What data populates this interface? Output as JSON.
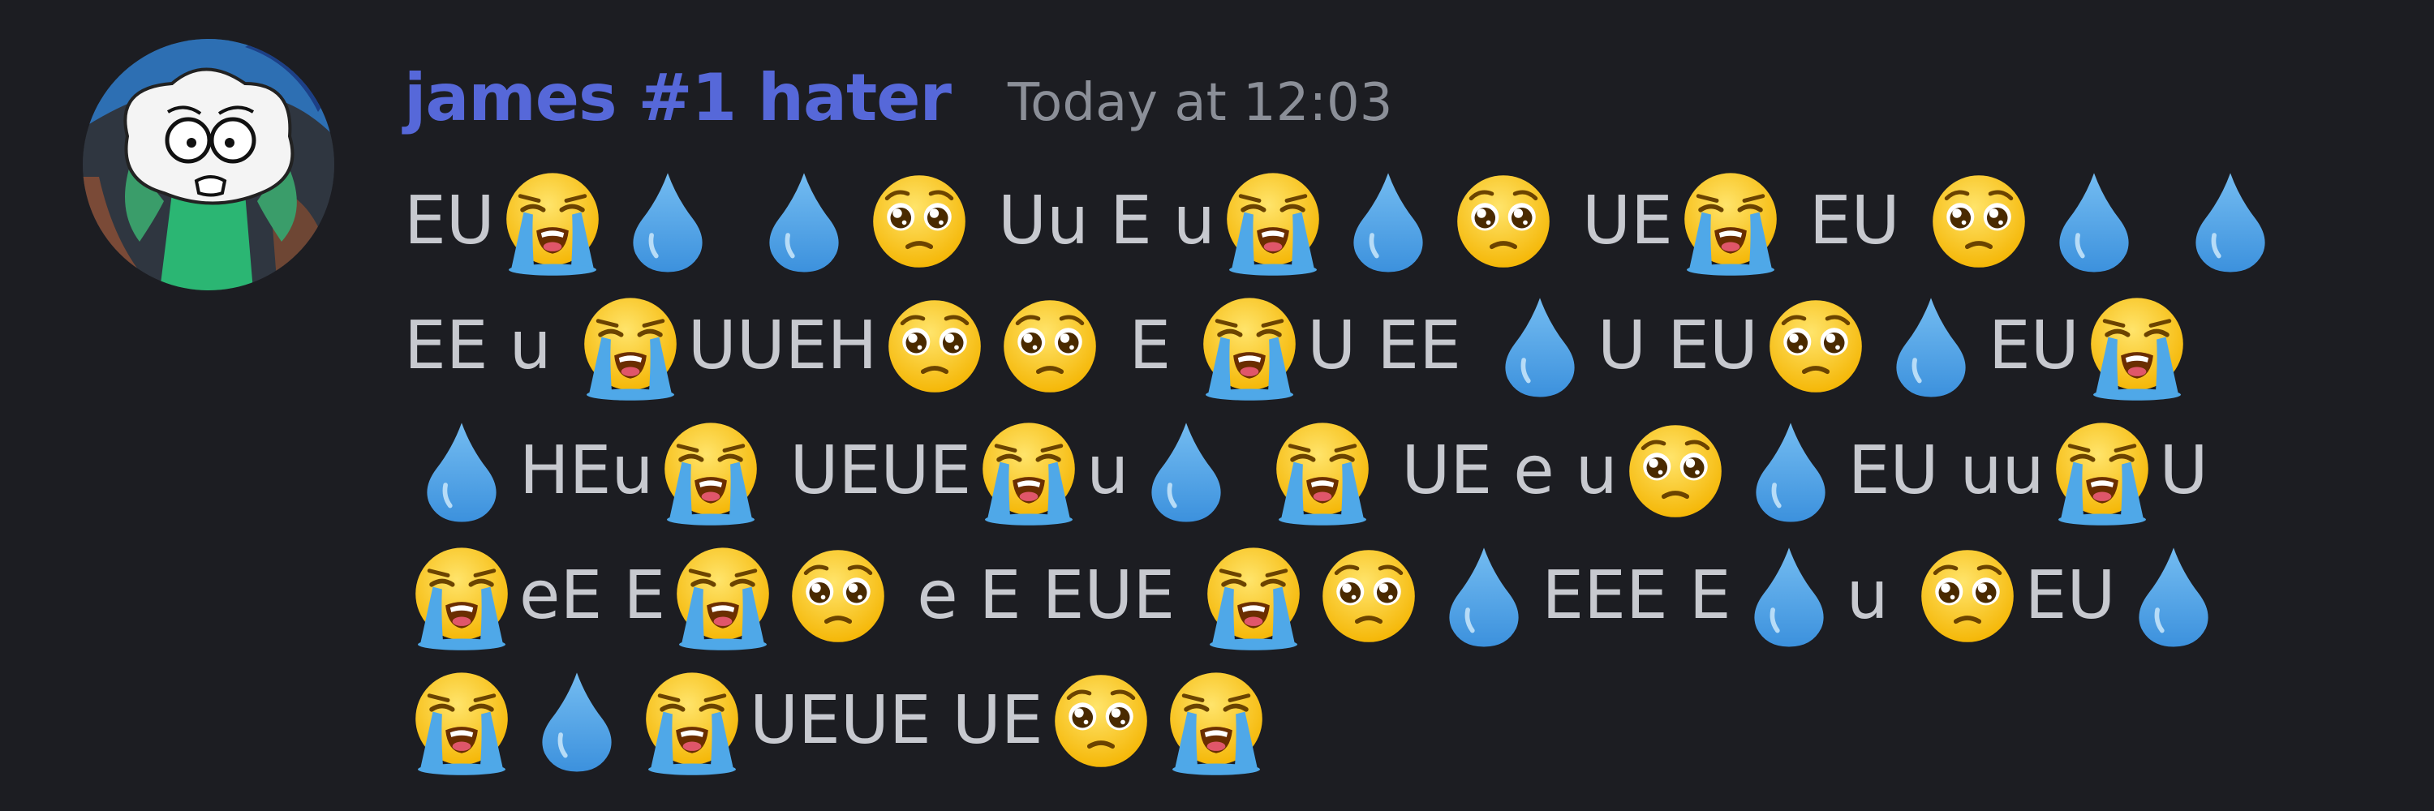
{
  "message": {
    "author": "james #1 hater",
    "timestamp": "Today at 12:03",
    "colors": {
      "author": "#5668d9",
      "timestamp": "#8b8f98",
      "text": "#c7c9cf",
      "background": "#1c1d22"
    },
    "lines": [
      [
        {
          "t": "text",
          "v": "EU"
        },
        {
          "t": "emoji",
          "v": "loudly-crying-face"
        },
        {
          "t": "emoji",
          "v": "droplet"
        },
        {
          "t": "text",
          "v": " "
        },
        {
          "t": "emoji",
          "v": "droplet"
        },
        {
          "t": "emoji",
          "v": "pleading-face"
        },
        {
          "t": "text",
          "v": " Uu E u"
        },
        {
          "t": "emoji",
          "v": "loudly-crying-face"
        },
        {
          "t": "emoji",
          "v": "droplet"
        },
        {
          "t": "emoji",
          "v": "pleading-face"
        },
        {
          "t": "text",
          "v": " UE"
        },
        {
          "t": "emoji",
          "v": "loudly-crying-face"
        },
        {
          "t": "text",
          "v": " EU "
        },
        {
          "t": "emoji",
          "v": "pleading-face"
        },
        {
          "t": "emoji",
          "v": "droplet"
        },
        {
          "t": "text",
          "v": " "
        },
        {
          "t": "emoji",
          "v": "droplet"
        }
      ],
      [
        {
          "t": "text",
          "v": "EE u "
        },
        {
          "t": "emoji",
          "v": "loudly-crying-face"
        },
        {
          "t": "text",
          "v": "UUEH"
        },
        {
          "t": "emoji",
          "v": "pleading-face"
        },
        {
          "t": "emoji",
          "v": "pleading-face"
        },
        {
          "t": "text",
          "v": " E "
        },
        {
          "t": "emoji",
          "v": "loudly-crying-face"
        },
        {
          "t": "text",
          "v": "U EE "
        },
        {
          "t": "emoji",
          "v": "droplet"
        },
        {
          "t": "text",
          "v": "U EU"
        },
        {
          "t": "emoji",
          "v": "pleading-face"
        },
        {
          "t": "emoji",
          "v": "droplet"
        },
        {
          "t": "text",
          "v": "EU"
        },
        {
          "t": "emoji",
          "v": "loudly-crying-face"
        }
      ],
      [
        {
          "t": "emoji",
          "v": "droplet"
        },
        {
          "t": "text",
          "v": "HEu"
        },
        {
          "t": "emoji",
          "v": "loudly-crying-face"
        },
        {
          "t": "text",
          "v": " UEUE"
        },
        {
          "t": "emoji",
          "v": "loudly-crying-face"
        },
        {
          "t": "text",
          "v": "u"
        },
        {
          "t": "emoji",
          "v": "droplet"
        },
        {
          "t": "text",
          "v": " "
        },
        {
          "t": "emoji",
          "v": "loudly-crying-face"
        },
        {
          "t": "text",
          "v": " UE e u"
        },
        {
          "t": "emoji",
          "v": "pleading-face"
        },
        {
          "t": "emoji",
          "v": "droplet"
        },
        {
          "t": "text",
          "v": "EU uu"
        },
        {
          "t": "emoji",
          "v": "loudly-crying-face"
        },
        {
          "t": "text",
          "v": "U"
        }
      ],
      [
        {
          "t": "emoji",
          "v": "loudly-crying-face"
        },
        {
          "t": "text",
          "v": "eE E"
        },
        {
          "t": "emoji",
          "v": "loudly-crying-face"
        },
        {
          "t": "emoji",
          "v": "pleading-face"
        },
        {
          "t": "text",
          "v": " e E EUE "
        },
        {
          "t": "emoji",
          "v": "loudly-crying-face"
        },
        {
          "t": "emoji",
          "v": "pleading-face"
        },
        {
          "t": "emoji",
          "v": "droplet"
        },
        {
          "t": "text",
          "v": "EEE E"
        },
        {
          "t": "emoji",
          "v": "droplet"
        },
        {
          "t": "text",
          "v": "u "
        },
        {
          "t": "emoji",
          "v": "pleading-face"
        },
        {
          "t": "text",
          "v": "EU"
        },
        {
          "t": "emoji",
          "v": "droplet"
        }
      ],
      [
        {
          "t": "emoji",
          "v": "loudly-crying-face"
        },
        {
          "t": "emoji",
          "v": "droplet"
        },
        {
          "t": "emoji",
          "v": "loudly-crying-face"
        },
        {
          "t": "text",
          "v": "UEUE UE"
        },
        {
          "t": "emoji",
          "v": "pleading-face"
        },
        {
          "t": "emoji",
          "v": "loudly-crying-face"
        }
      ]
    ]
  }
}
